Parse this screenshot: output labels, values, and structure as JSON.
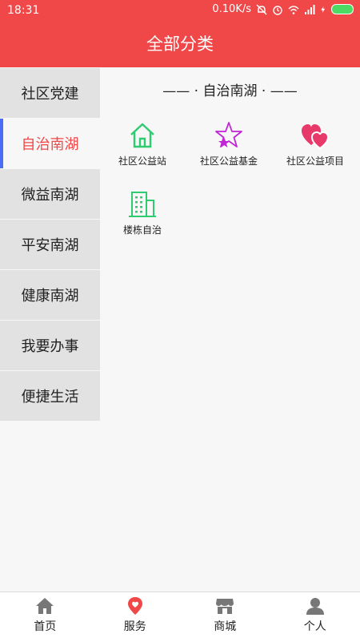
{
  "status": {
    "time": "18:31",
    "speed": "0.10K/s"
  },
  "header": {
    "title": "全部分类"
  },
  "sidebar": {
    "items": [
      {
        "label": "社区党建"
      },
      {
        "label": "自治南湖",
        "active": true
      },
      {
        "label": "微益南湖"
      },
      {
        "label": "平安南湖"
      },
      {
        "label": "健康南湖"
      },
      {
        "label": "我要办事"
      },
      {
        "label": "便捷生活"
      }
    ]
  },
  "main": {
    "section_title": "—— · 自治南湖 · ——",
    "items": [
      {
        "label": "社区公益站",
        "icon": "house-icon",
        "color": "#2ecc71"
      },
      {
        "label": "社区公益基金",
        "icon": "star-icon",
        "color": "#c026d3"
      },
      {
        "label": "社区公益项目",
        "icon": "hearts-icon",
        "color": "#e83a6a"
      },
      {
        "label": "楼栋自治",
        "icon": "building-icon",
        "color": "#2ecc71"
      }
    ]
  },
  "bottom_nav": {
    "items": [
      {
        "label": "首页",
        "icon": "home-icon"
      },
      {
        "label": "服务",
        "icon": "location-pin-icon",
        "active": true
      },
      {
        "label": "商城",
        "icon": "store-icon"
      },
      {
        "label": "个人",
        "icon": "person-icon"
      }
    ]
  },
  "colors": {
    "brand": "#f04848",
    "active_indicator": "#4a6cf7"
  }
}
